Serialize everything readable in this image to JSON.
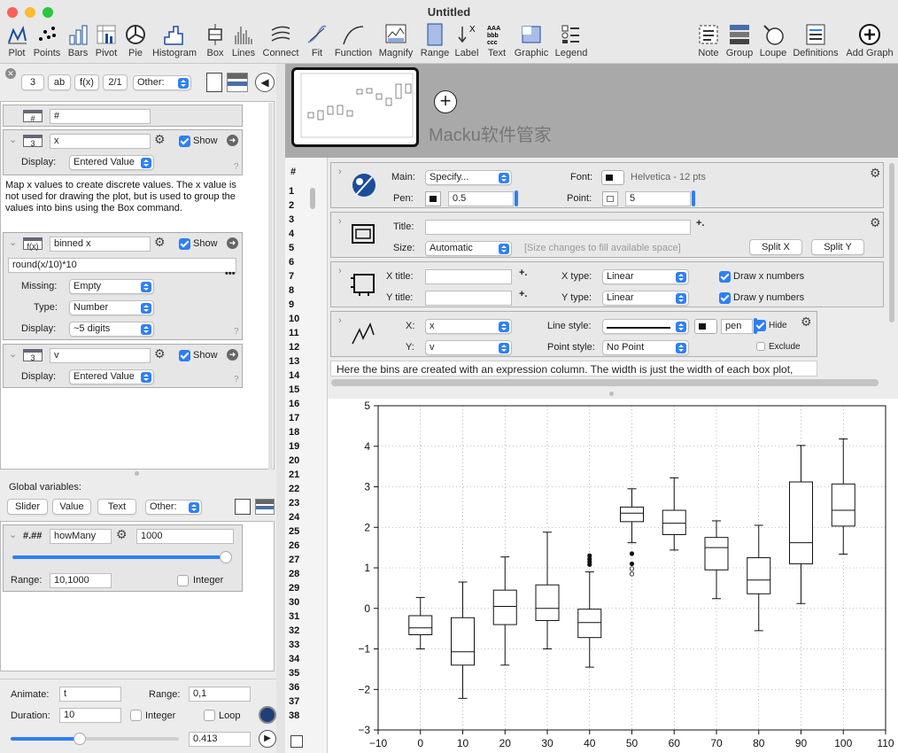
{
  "window": {
    "title": "Untitled"
  },
  "toolbar": {
    "items": [
      "Plot",
      "Points",
      "Bars",
      "Pivot",
      "Pie",
      "Histogram",
      "Box",
      "Lines",
      "Connect",
      "Fit",
      "Function",
      "Magnify",
      "Range",
      "Label",
      "Text",
      "Graphic",
      "Legend"
    ],
    "right_items": [
      "Note",
      "Group",
      "Loupe",
      "Definitions",
      "Add Graph"
    ]
  },
  "left": {
    "toprow": {
      "btn1": "3",
      "btn2": "ab",
      "btn3": "f(x)",
      "btn4": "2/1",
      "other": "Other:"
    },
    "col_hash": {
      "name": "#"
    },
    "col_x": {
      "name": "x",
      "show": "Show",
      "display_label": "Display:",
      "display_value": "Entered Value",
      "help": "?",
      "note": "Map x values to create discrete values.  The x value is not used for drawing the plot, but is used to group the values into bins using the Box command."
    },
    "col_binned": {
      "name": "binned x",
      "show": "Show",
      "expr": "round(x/10)*10",
      "missing_label": "Missing:",
      "missing_value": "Empty",
      "type_label": "Type:",
      "type_value": "Number",
      "display_label": "Display:",
      "display_value": "~5 digits",
      "help": "?"
    },
    "col_v": {
      "name": "v",
      "show": "Show",
      "display_label": "Display:",
      "display_value": "Entered Value",
      "help": "?"
    },
    "globals": {
      "title": "Global variables:",
      "slider": "Slider",
      "value": "Value",
      "text": "Text",
      "other": "Other:",
      "var_type": "#.##",
      "var_name": "howMany",
      "var_value": "1000",
      "range_label": "Range:",
      "range_value": "10,1000",
      "integer": "Integer",
      "slider_fraction": 0.97
    },
    "animate": {
      "animate_label": "Animate:",
      "animate_value": "t",
      "range_label": "Range:",
      "range_value": "0,1",
      "duration_label": "Duration:",
      "duration_value": "10",
      "integer": "Integer",
      "loop": "Loop",
      "current": "0.413",
      "slider_fraction": 0.413
    }
  },
  "thumb": {
    "watermark": "Macku软件管家"
  },
  "rows": {
    "header": "#",
    "numbers": [
      "1",
      "2",
      "3",
      "4",
      "5",
      "6",
      "7",
      "8",
      "9",
      "10",
      "11",
      "12",
      "13",
      "14",
      "15",
      "16",
      "17",
      "18",
      "19",
      "20",
      "21",
      "22",
      "23",
      "24",
      "25",
      "26",
      "27",
      "28",
      "29",
      "30",
      "31",
      "32",
      "33",
      "34",
      "35",
      "36",
      "37",
      "38"
    ]
  },
  "settings": {
    "main_label": "Main:",
    "main_value": "Specify...",
    "font_label": "Font:",
    "font_value": "Helvetica - 12 pts",
    "pen_label": "Pen:",
    "pen_value": "0.5",
    "point_label": "Point:",
    "point_value": "5",
    "title_label": "Title:",
    "size_label": "Size:",
    "size_value": "Automatic",
    "size_hint": "[Size changes to fill available space]",
    "splitx": "Split X",
    "splity": "Split Y",
    "xtitle_label": "X title:",
    "ytitle_label": "Y title:",
    "xtype_label": "X type:",
    "xtype_value": "Linear",
    "ytype_label": "Y type:",
    "ytype_value": "Linear",
    "drawx": "Draw x numbers",
    "drawy": "Draw y numbers",
    "x_label": "X:",
    "x_value": "x",
    "y_label": "Y:",
    "y_value": "v",
    "linestyle_label": "Line style:",
    "pen_name": "pen",
    "hide": "Hide",
    "pointstyle_label": "Point style:",
    "pointstyle_value": "No Point",
    "exclude": "Exclude",
    "note": "Here the bins are created with an expression column.  The width is just the width of each box plot,"
  },
  "chart_data": {
    "type": "box",
    "xlim": [
      -10,
      110
    ],
    "ylim": [
      -3,
      5
    ],
    "xticks": [
      "−10",
      "0",
      "10",
      "20",
      "30",
      "40",
      "50",
      "60",
      "70",
      "80",
      "90",
      "100",
      "110"
    ],
    "yticks": [
      "−3",
      "−2",
      "−1",
      "0",
      "1",
      "2",
      "3",
      "4",
      "5"
    ],
    "grid": true,
    "boxes": [
      {
        "x": 0,
        "min": -1.0,
        "q1": -0.65,
        "median": -0.48,
        "q3": -0.18,
        "max": 0.27,
        "outliers": []
      },
      {
        "x": 10,
        "min": -2.22,
        "q1": -1.4,
        "median": -1.07,
        "q3": -0.23,
        "max": 0.65,
        "outliers": []
      },
      {
        "x": 20,
        "min": -1.4,
        "q1": -0.4,
        "median": 0.05,
        "q3": 0.45,
        "max": 1.27,
        "outliers": []
      },
      {
        "x": 30,
        "min": -1.0,
        "q1": -0.3,
        "median": 0.0,
        "q3": 0.58,
        "max": 1.88,
        "outliers": []
      },
      {
        "x": 40,
        "min": -1.45,
        "q1": -0.72,
        "median": -0.35,
        "q3": -0.02,
        "max": 0.9,
        "outliers": [
          1.3,
          1.22,
          1.15,
          1.08
        ]
      },
      {
        "x": 50,
        "min": 1.62,
        "q1": 2.14,
        "median": 2.35,
        "q3": 2.5,
        "max": 2.95,
        "outliers": [
          1.35,
          1.1,
          0.98,
          0.85
        ]
      },
      {
        "x": 60,
        "min": 1.44,
        "q1": 1.82,
        "median": 2.1,
        "q3": 2.42,
        "max": 3.22,
        "outliers": []
      },
      {
        "x": 70,
        "min": 0.24,
        "q1": 0.95,
        "median": 1.5,
        "q3": 1.75,
        "max": 2.16,
        "outliers": []
      },
      {
        "x": 80,
        "min": -0.55,
        "q1": 0.36,
        "median": 0.7,
        "q3": 1.25,
        "max": 2.05,
        "outliers": []
      },
      {
        "x": 90,
        "min": 0.12,
        "q1": 1.1,
        "median": 1.62,
        "q3": 3.12,
        "max": 4.02,
        "outliers": []
      },
      {
        "x": 100,
        "min": 1.34,
        "q1": 2.03,
        "median": 2.42,
        "q3": 3.07,
        "max": 4.18,
        "outliers": []
      }
    ]
  }
}
